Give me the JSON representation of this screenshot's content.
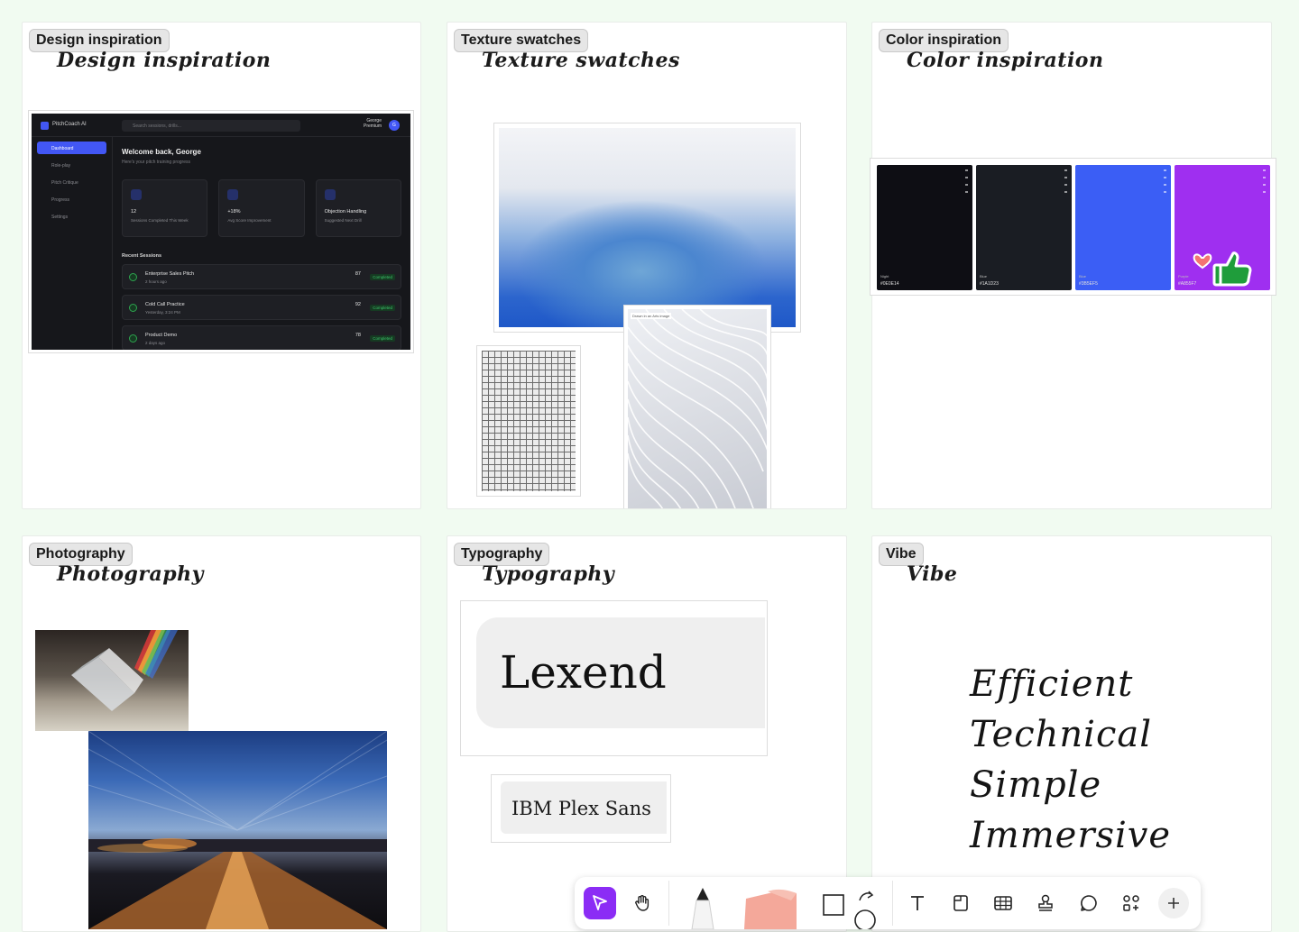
{
  "sections": {
    "design": {
      "tag": "Design inspiration",
      "hand": "Design inspiration"
    },
    "texture": {
      "tag": "Texture swatches",
      "hand": "Texture swatches"
    },
    "color": {
      "tag": "Color inspiration",
      "hand": "Color inspiration"
    },
    "photo": {
      "tag": "Photography",
      "hand": "Photography"
    },
    "type": {
      "tag": "Typography",
      "hand": "Typography"
    },
    "vibe": {
      "tag": "Vibe",
      "hand": "Vibe"
    }
  },
  "mockup": {
    "app_name": "PitchCoach AI",
    "search_placeholder": "Search sessions, drills...",
    "user_name": "George",
    "user_plan": "Premium",
    "avatar_letter": "G",
    "nav": [
      "Dashboard",
      "Role-play",
      "Pitch Critique",
      "Progress",
      "Settings"
    ],
    "welcome": "Welcome back, George",
    "welcome_sub": "Here's your pitch training progress",
    "stats": [
      {
        "value": "12",
        "label": "Sessions Completed This Week"
      },
      {
        "value": "+18%",
        "label": "Avg Score Improvement"
      },
      {
        "value": "Objection Handling",
        "label": "Suggested Next Drill"
      }
    ],
    "recent_title": "Recent Sessions",
    "sessions": [
      {
        "name": "Enterprise Sales Pitch",
        "time": "2 hours ago",
        "score": "87",
        "status": "Completed"
      },
      {
        "name": "Cold Call Practice",
        "time": "Yesterday, 3:24 PM",
        "score": "92",
        "status": "Completed"
      },
      {
        "name": "Product Demo",
        "time": "2 days ago",
        "score": "78",
        "status": "Completed"
      }
    ],
    "score_label": "Score"
  },
  "texture": {
    "wave_caption": "Drawn in an Arts image"
  },
  "palette": {
    "swatches": [
      {
        "name": "Night",
        "hex": "#0E0E14",
        "color": "#0e0e14"
      },
      {
        "name": "Blue",
        "hex": "#1A1D23",
        "color": "#1a1d23"
      },
      {
        "name": "Blue",
        "hex": "#3B5EF5",
        "color": "#3b5ef5"
      },
      {
        "name": "Purple",
        "hex": "#A855F7",
        "color": "#9f2ff0"
      }
    ]
  },
  "typography": {
    "primary": "Lexend",
    "secondary": "IBM Plex Sans"
  },
  "vibe": {
    "words": [
      "Efficient",
      "Technical",
      "Simple",
      "Immersive"
    ]
  },
  "toolbar": {
    "tools": [
      "select-tool",
      "hand-tool",
      "pen-tool",
      "sticky-note-tool",
      "shapes-tool",
      "text-tool",
      "frame-tool",
      "table-tool",
      "stamp-tool",
      "comment-tool",
      "widgets-tool",
      "add-tool"
    ],
    "accent": "#8b2cf5"
  }
}
